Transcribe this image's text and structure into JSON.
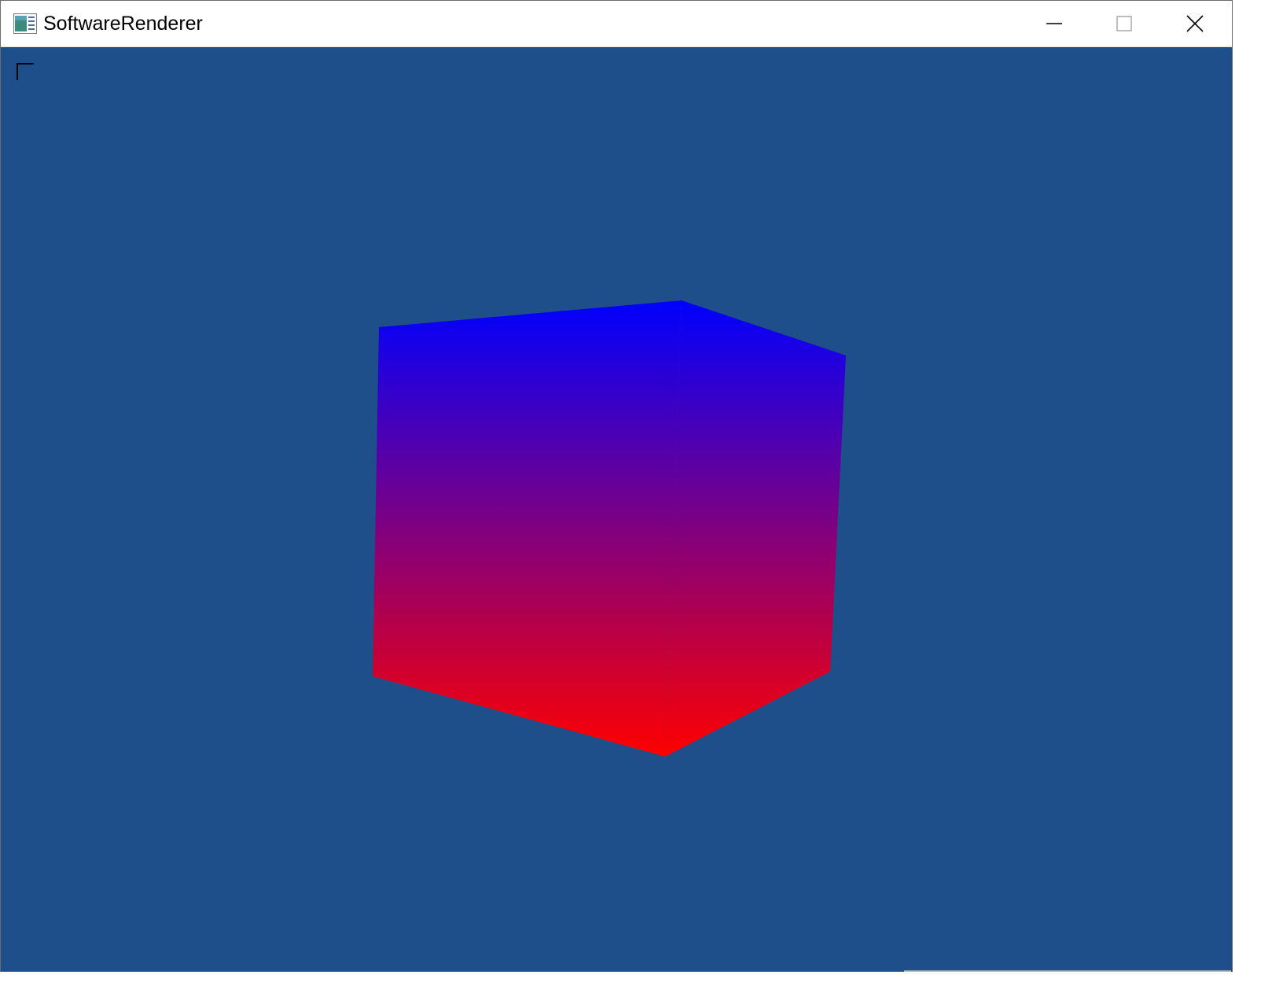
{
  "window": {
    "title": "SoftwareRenderer",
    "icon": "app-window-icon",
    "controls": {
      "minimize": "minimize-icon",
      "maximize": "maximize-icon",
      "close": "close-icon"
    }
  },
  "viewport": {
    "background_color": "#1f4f8a",
    "cube": {
      "top_color": "#0000ff",
      "bottom_color": "#ff0000"
    }
  }
}
